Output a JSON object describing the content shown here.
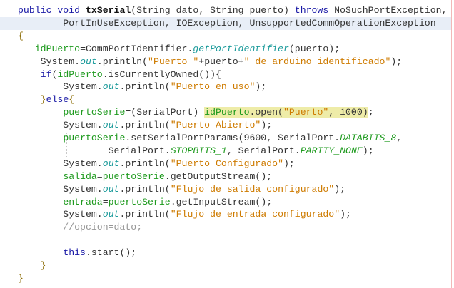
{
  "code": {
    "lines": [
      [
        [
          "public void ",
          "k"
        ],
        [
          "txSerial",
          "m"
        ],
        [
          "(String dato, String puerto) ",
          "p"
        ],
        [
          "throws",
          "k"
        ],
        [
          " NoSuchPortException,",
          "p"
        ]
      ],
      [
        [
          "        PortInUseException, IOException, UnsupportedCommOperationException",
          "p"
        ]
      ],
      [
        [
          "{",
          "b"
        ]
      ],
      [
        [
          "   ",
          "p"
        ],
        [
          "idPuerto",
          "f"
        ],
        [
          "=CommPortIdentifier.",
          "p"
        ],
        [
          "getPortIdentifier",
          "o"
        ],
        [
          "(puerto);",
          "p"
        ]
      ],
      [
        [
          "    System.",
          "p"
        ],
        [
          "out",
          "o"
        ],
        [
          ".println(",
          "p"
        ],
        [
          "\"Puerto \"",
          "s"
        ],
        [
          "+puerto+",
          "p"
        ],
        [
          "\" de arduino identificado\"",
          "s"
        ],
        [
          ");",
          "p"
        ]
      ],
      [
        [
          "    ",
          "p"
        ],
        [
          "if",
          "k"
        ],
        [
          "(",
          "p"
        ],
        [
          "idPuerto",
          "f"
        ],
        [
          ".isCurrentlyOwned()){",
          "p"
        ]
      ],
      [
        [
          "        System.",
          "p"
        ],
        [
          "out",
          "o"
        ],
        [
          ".println(",
          "p"
        ],
        [
          "\"Puerto en uso\"",
          "s"
        ],
        [
          ");",
          "p"
        ]
      ],
      [
        [
          "    }",
          "b"
        ],
        [
          "else",
          "k"
        ],
        [
          "{",
          "b"
        ]
      ],
      [
        [
          "        ",
          "p"
        ],
        [
          "puertoSerie",
          "f"
        ],
        [
          "=(SerialPort) ",
          "p"
        ],
        [
          "idPuerto",
          "f mark"
        ],
        [
          ".open(",
          "p mark"
        ],
        [
          "\"Puerto\"",
          "s mark"
        ],
        [
          ", 1000)",
          "p mark"
        ],
        [
          ";",
          "p"
        ]
      ],
      [
        [
          "        System.",
          "p"
        ],
        [
          "out",
          "o"
        ],
        [
          ".println(",
          "p"
        ],
        [
          "\"Puerto Abierto\"",
          "s"
        ],
        [
          ");",
          "p"
        ]
      ],
      [
        [
          "        ",
          "p"
        ],
        [
          "puertoSerie",
          "f"
        ],
        [
          ".setSerialPortParams(9600, SerialPort.",
          "p"
        ],
        [
          "DATABITS_8",
          "c"
        ],
        [
          ",",
          "p"
        ]
      ],
      [
        [
          "                SerialPort.",
          "p"
        ],
        [
          "STOPBITS_1",
          "c"
        ],
        [
          ", SerialPort.",
          "p"
        ],
        [
          "PARITY_NONE",
          "c"
        ],
        [
          ");",
          "p"
        ]
      ],
      [
        [
          "        System.",
          "p"
        ],
        [
          "out",
          "o"
        ],
        [
          ".println(",
          "p"
        ],
        [
          "\"Puerto Configurado\"",
          "s"
        ],
        [
          ");",
          "p"
        ]
      ],
      [
        [
          "        ",
          "p"
        ],
        [
          "salida",
          "f"
        ],
        [
          "=",
          "p"
        ],
        [
          "puertoSerie",
          "f"
        ],
        [
          ".getOutputStream();",
          "p"
        ]
      ],
      [
        [
          "        System.",
          "p"
        ],
        [
          "out",
          "o"
        ],
        [
          ".println(",
          "p"
        ],
        [
          "\"Flujo de salida configurado\"",
          "s"
        ],
        [
          ");",
          "p"
        ]
      ],
      [
        [
          "        ",
          "p"
        ],
        [
          "entrada",
          "f"
        ],
        [
          "=",
          "p"
        ],
        [
          "puertoSerie",
          "f"
        ],
        [
          ".getInputStream();",
          "p"
        ]
      ],
      [
        [
          "        System.",
          "p"
        ],
        [
          "out",
          "o"
        ],
        [
          ".println(",
          "p"
        ],
        [
          "\"Flujo de entrada configurado\"",
          "s"
        ],
        [
          ");",
          "p"
        ]
      ],
      [
        [
          "        //opcion=dato;",
          "cm"
        ]
      ],
      [
        [
          "",
          "p"
        ]
      ],
      [
        [
          "        ",
          "p"
        ],
        [
          "this",
          "k"
        ],
        [
          ".start();",
          "p"
        ]
      ],
      [
        [
          "    }",
          "b"
        ]
      ],
      [
        [
          "}",
          "b"
        ]
      ]
    ]
  }
}
